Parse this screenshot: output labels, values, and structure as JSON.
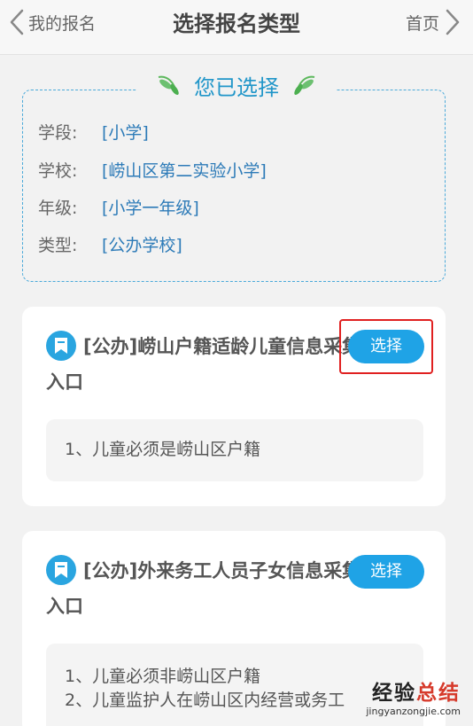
{
  "header": {
    "back_label": "我的报名",
    "title": "选择报名类型",
    "home_label": "首页"
  },
  "selection": {
    "title": "您已选择",
    "rows": [
      {
        "key": "学段:",
        "value": "[小学]"
      },
      {
        "key": "学校:",
        "value": "[崂山区第二实验小学]"
      },
      {
        "key": "年级:",
        "value": "[小学一年级]"
      },
      {
        "key": "类型:",
        "value": "[公办学校]"
      }
    ]
  },
  "options": [
    {
      "title": "[公办]崂山户籍适龄儿童信息采集入口",
      "button": "选择",
      "notes": [
        "1、儿童必须是崂山区户籍"
      ]
    },
    {
      "title": "[公办]外来务工人员子女信息采集入口",
      "button": "选择",
      "notes": [
        "1、儿童必须非崂山区户籍",
        "2、儿童监护人在崂山区内经营或务工"
      ]
    }
  ],
  "watermark": {
    "text_main": "经验",
    "text_accent": "总结",
    "url": "jingyanzongjie.com"
  },
  "colors": {
    "accent": "#1fa3e6",
    "value_text": "#2d7bb8",
    "highlight_frame": "#e02020"
  }
}
